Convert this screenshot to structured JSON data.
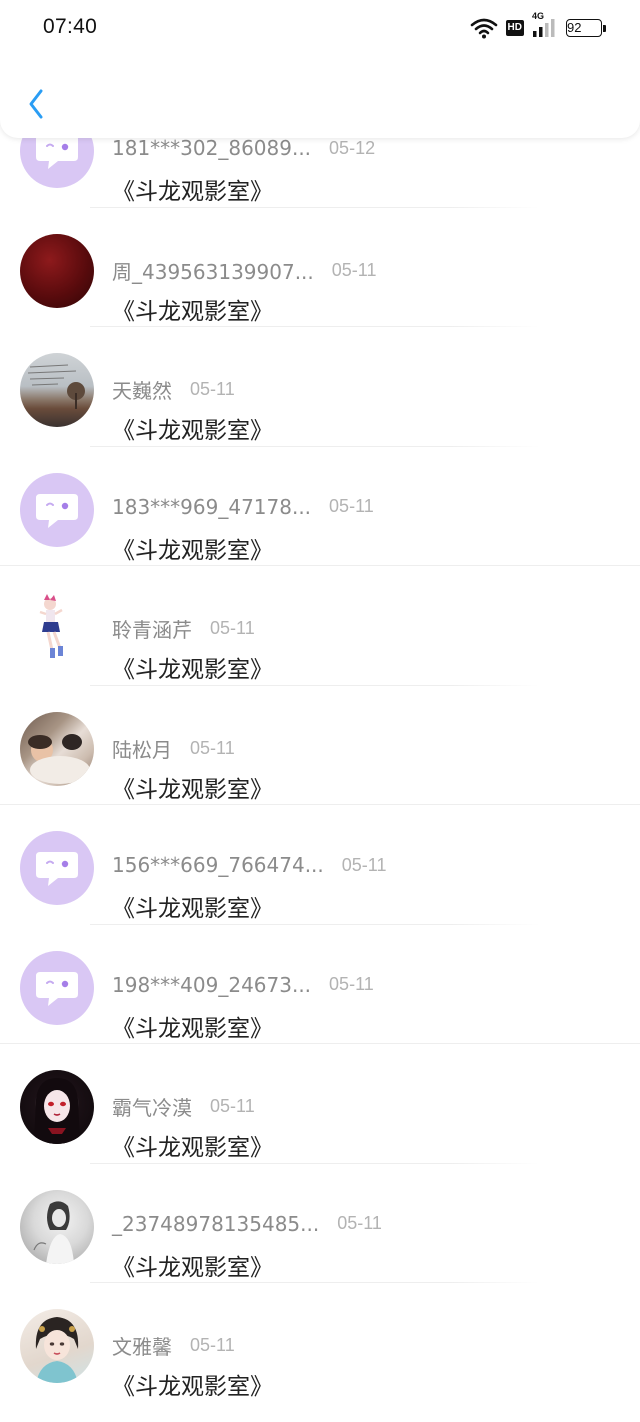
{
  "status_bar": {
    "time": "07:40",
    "network": "4G",
    "hd": "HD",
    "battery": "92"
  },
  "header": {
    "back_icon": "chevron-left-icon",
    "accent_color": "#2a9df4"
  },
  "comments": [
    {
      "name": "181***302_86089...",
      "date": "05-12",
      "text": "《斗龙观影室》",
      "avatar": "default-bubble"
    },
    {
      "name": "周_439563139907...",
      "date": "05-11",
      "text": "《斗龙观影室》",
      "avatar": "dark-red-ball"
    },
    {
      "name": "天巍然",
      "date": "05-11",
      "text": "《斗龙观影室》",
      "avatar": "sunset-handwriting"
    },
    {
      "name": "183***969_47178...",
      "date": "05-11",
      "text": "《斗龙观影室》",
      "avatar": "default-bubble"
    },
    {
      "name": "聆青涵芹",
      "date": "05-11",
      "text": "《斗龙观影室》",
      "avatar": "anime-figure"
    },
    {
      "name": "陆松月",
      "date": "05-11",
      "text": "《斗龙观影室》",
      "avatar": "sleeping-child-cat"
    },
    {
      "name": "156***669_766474...",
      "date": "05-11",
      "text": "《斗龙观影室》",
      "avatar": "default-bubble"
    },
    {
      "name": "198***409_24673...",
      "date": "05-11",
      "text": "《斗龙观影室》",
      "avatar": "default-bubble"
    },
    {
      "name": "霸气冷漠",
      "date": "05-11",
      "text": "《斗龙观影室》",
      "avatar": "dark-anime-girl"
    },
    {
      "name": "_23748978135485...",
      "date": "05-11",
      "text": "《斗龙观影室》",
      "avatar": "grayscale-girl"
    },
    {
      "name": "文雅馨",
      "date": "05-11",
      "text": "《斗龙观影室》",
      "avatar": "painted-lady"
    }
  ]
}
